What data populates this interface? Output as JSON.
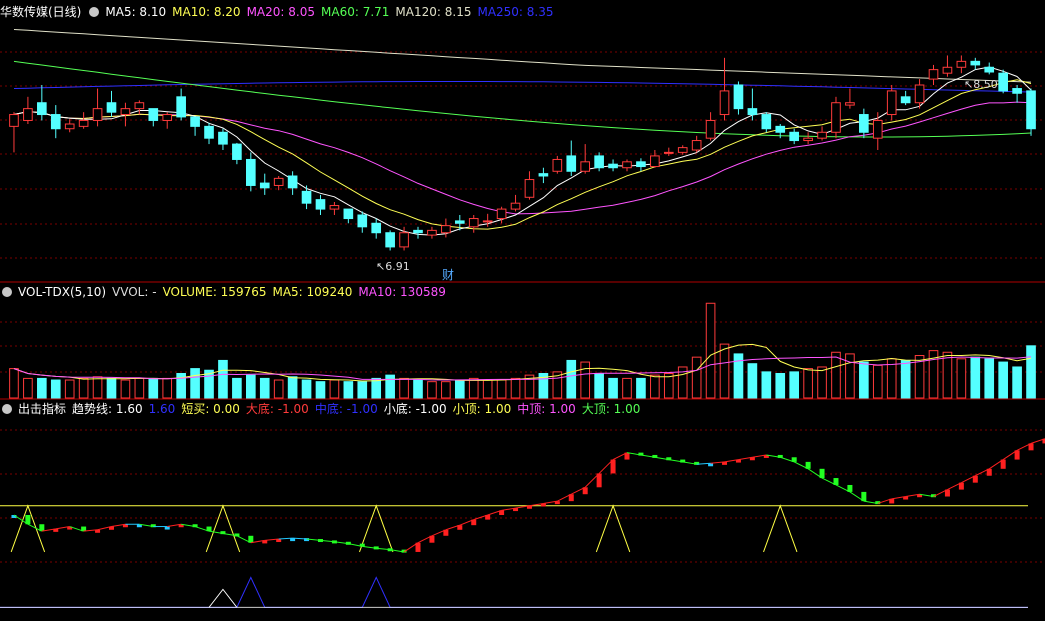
{
  "colors": {
    "up": "#ff3b3b",
    "down": "#54ffff",
    "grid": "#7a0000",
    "ma5": "#ffffff",
    "ma10": "#ffff55",
    "ma20": "#ff55ff",
    "ma60": "#55ff55",
    "ma120": "#e0e0c8",
    "ma250": "#3030ff",
    "trend_up": "#ff2020",
    "trend_down": "#22ff22",
    "trend_flat": "#22c8ff",
    "signal": "#ffff44",
    "signal2": "#3030ff",
    "fin_badge": "#55aaff"
  },
  "price_panel": {
    "title": "华数传媒(日线)",
    "legend": [
      {
        "label": "MA5: 8.10",
        "color": "#ffffff"
      },
      {
        "label": "MA10: 8.20",
        "color": "#ffff55"
      },
      {
        "label": "MA20: 8.05",
        "color": "#ff55ff"
      },
      {
        "label": "MA60: 7.71",
        "color": "#55ff55"
      },
      {
        "label": "MA120: 8.15",
        "color": "#e0e0c8"
      },
      {
        "label": "MA250: 8.35",
        "color": "#3030ff"
      }
    ],
    "high_label": "8.50",
    "low_label": "6.91",
    "fin_badge": "财"
  },
  "volume_panel": {
    "title": "VOL-TDX(5,10)",
    "legend": [
      {
        "label": "VVOL: -",
        "color": "#dddddd"
      },
      {
        "label": "VOLUME: 159765",
        "color": "#ffff55"
      },
      {
        "label": "MA5: 109240",
        "color": "#ffff55"
      },
      {
        "label": "MA10: 130589",
        "color": "#ff55ff"
      }
    ]
  },
  "indicator_panel": {
    "title": "出击指标",
    "legend": [
      {
        "label": "趋势线: 1.60",
        "color": "#ffffff"
      },
      {
        "label": "1.60",
        "color": "#3030ff"
      },
      {
        "label": "短买: 0.00",
        "color": "#ffff55"
      },
      {
        "label": "大底: -1.00",
        "color": "#ff3b3b"
      },
      {
        "label": "中底: -1.00",
        "color": "#3030ff"
      },
      {
        "label": "小底: -1.00",
        "color": "#ffffff"
      },
      {
        "label": "小顶: 1.00",
        "color": "#ffff55"
      },
      {
        "label": "中顶: 1.00",
        "color": "#ff55ff"
      },
      {
        "label": "大顶: 1.00",
        "color": "#55ff55"
      }
    ]
  },
  "chart_data": [
    {
      "type": "candlestick",
      "ylim": [
        6.7,
        8.9
      ],
      "candles": [
        [
          8.0,
          8.1,
          7.85,
          7.78,
          8.12
        ],
        [
          8.05,
          8.15,
          8.2,
          8.02,
          8.25
        ],
        [
          8.2,
          8.1,
          8.3,
          8.05,
          8.35
        ],
        [
          8.1,
          7.98,
          8.15,
          7.9,
          8.18
        ],
        [
          7.98,
          8.02,
          8.05,
          7.95,
          8.06
        ],
        [
          8.0,
          8.05,
          8.1,
          7.98,
          8.12
        ],
        [
          8.05,
          8.15,
          8.3,
          8.0,
          8.32
        ],
        [
          8.2,
          8.12,
          8.28,
          8.08,
          8.3
        ],
        [
          8.1,
          8.15,
          8.1,
          8.0,
          8.2
        ],
        [
          8.15,
          8.2,
          8.15,
          8.1,
          8.22
        ],
        [
          8.15,
          8.05,
          8.1,
          8.0,
          8.12
        ],
        [
          8.05,
          8.1,
          8.05,
          7.98,
          8.12
        ],
        [
          8.25,
          8.08,
          8.3,
          8.05,
          8.32
        ],
        [
          8.08,
          8.0,
          8.05,
          7.92,
          8.06
        ],
        [
          8.0,
          7.9,
          8.02,
          7.85,
          8.03
        ],
        [
          7.95,
          7.85,
          7.95,
          7.8,
          7.98
        ],
        [
          7.85,
          7.72,
          7.82,
          7.68,
          7.86
        ],
        [
          7.72,
          7.5,
          7.75,
          7.45,
          7.78
        ],
        [
          7.52,
          7.48,
          7.58,
          7.42,
          7.6
        ],
        [
          7.5,
          7.56,
          7.55,
          7.46,
          7.58
        ],
        [
          7.58,
          7.48,
          7.6,
          7.42,
          7.62
        ],
        [
          7.45,
          7.35,
          7.48,
          7.3,
          7.5
        ],
        [
          7.38,
          7.3,
          7.4,
          7.25,
          7.42
        ],
        [
          7.3,
          7.33,
          7.3,
          7.25,
          7.36
        ],
        [
          7.3,
          7.22,
          7.28,
          7.18,
          7.3
        ],
        [
          7.25,
          7.15,
          7.26,
          7.1,
          7.28
        ],
        [
          7.18,
          7.1,
          7.2,
          7.05,
          7.22
        ],
        [
          7.1,
          6.98,
          7.08,
          6.95,
          7.12
        ],
        [
          6.98,
          7.1,
          7.05,
          6.95,
          7.15
        ],
        [
          7.12,
          7.1,
          7.12,
          7.05,
          7.15
        ],
        [
          7.08,
          7.12,
          7.1,
          7.05,
          7.15
        ],
        [
          7.1,
          7.16,
          7.18,
          7.06,
          7.22
        ],
        [
          7.2,
          7.18,
          7.22,
          7.12,
          7.25
        ],
        [
          7.15,
          7.22,
          7.18,
          7.1,
          7.25
        ],
        [
          7.2,
          7.2,
          7.22,
          7.15,
          7.26
        ],
        [
          7.22,
          7.3,
          7.28,
          7.18,
          7.32
        ],
        [
          7.3,
          7.35,
          7.4,
          7.28,
          7.42
        ],
        [
          7.4,
          7.55,
          7.6,
          7.38,
          7.62
        ],
        [
          7.6,
          7.58,
          7.62,
          7.52,
          7.65
        ],
        [
          7.62,
          7.72,
          7.7,
          7.6,
          7.75
        ],
        [
          7.75,
          7.62,
          7.78,
          7.58,
          7.88
        ],
        [
          7.62,
          7.7,
          7.75,
          7.6,
          7.85
        ],
        [
          7.75,
          7.65,
          7.7,
          7.62,
          7.78
        ],
        [
          7.68,
          7.65,
          7.7,
          7.62,
          7.72
        ],
        [
          7.65,
          7.7,
          7.68,
          7.62,
          7.72
        ],
        [
          7.7,
          7.66,
          7.7,
          7.62,
          7.73
        ],
        [
          7.66,
          7.75,
          7.78,
          7.65,
          7.8
        ],
        [
          7.78,
          7.78,
          7.8,
          7.75,
          7.82
        ],
        [
          7.78,
          7.82,
          7.8,
          7.76,
          7.84
        ],
        [
          7.8,
          7.88,
          7.9,
          7.78,
          7.92
        ],
        [
          7.9,
          8.05,
          8.1,
          7.88,
          8.12
        ],
        [
          8.1,
          8.3,
          8.35,
          8.05,
          8.58
        ],
        [
          8.35,
          8.15,
          8.2,
          8.1,
          8.38
        ],
        [
          8.15,
          8.1,
          8.15,
          8.05,
          8.32
        ],
        [
          8.1,
          7.98,
          8.05,
          7.95,
          8.12
        ],
        [
          8.0,
          7.95,
          7.98,
          7.9,
          8.02
        ],
        [
          7.95,
          7.88,
          7.95,
          7.85,
          7.98
        ],
        [
          7.88,
          7.9,
          7.92,
          7.85,
          7.95
        ],
        [
          7.9,
          7.95,
          7.95,
          7.88,
          8.0
        ],
        [
          7.95,
          8.2,
          8.22,
          7.9,
          8.25
        ],
        [
          8.18,
          8.2,
          8.25,
          8.15,
          8.32
        ],
        [
          8.1,
          7.95,
          8.1,
          7.9,
          8.15
        ],
        [
          7.9,
          8.05,
          8.1,
          7.8,
          8.12
        ],
        [
          8.1,
          8.3,
          8.32,
          8.05,
          8.35
        ],
        [
          8.25,
          8.2,
          8.25,
          8.18,
          8.3
        ],
        [
          8.2,
          8.35,
          8.38,
          8.15,
          8.4
        ],
        [
          8.4,
          8.48,
          8.45,
          8.35,
          8.52
        ],
        [
          8.45,
          8.5,
          8.48,
          8.42,
          8.6
        ],
        [
          8.5,
          8.55,
          8.52,
          8.45,
          8.6
        ],
        [
          8.55,
          8.52,
          8.52,
          8.48,
          8.58
        ],
        [
          8.5,
          8.46,
          8.5,
          8.44,
          8.54
        ],
        [
          8.45,
          8.3,
          8.4,
          8.28,
          8.48
        ],
        [
          8.32,
          8.28,
          8.32,
          8.2,
          8.35
        ],
        [
          8.3,
          7.98,
          8.28,
          7.92,
          8.32
        ]
      ]
    },
    {
      "type": "bar",
      "ylim": [
        0,
        300000
      ],
      "values": [
        90000,
        60000,
        60000,
        55000,
        55000,
        60000,
        65000,
        60000,
        55000,
        60000,
        60000,
        60000,
        75000,
        90000,
        85000,
        115000,
        60000,
        70000,
        60000,
        55000,
        65000,
        55000,
        50000,
        55000,
        50000,
        50000,
        60000,
        70000,
        60000,
        55000,
        50000,
        50000,
        55000,
        60000,
        55000,
        55000,
        60000,
        70000,
        75000,
        80000,
        115000,
        110000,
        75000,
        60000,
        60000,
        60000,
        70000,
        75000,
        95000,
        125000,
        290000,
        165000,
        135000,
        105000,
        80000,
        75000,
        80000,
        90000,
        95000,
        140000,
        135000,
        110000,
        100000,
        120000,
        115000,
        130000,
        145000,
        140000,
        120000,
        125000,
        120000,
        110000,
        95000,
        159765
      ],
      "series_ma": [
        "ma5",
        "ma10"
      ]
    },
    {
      "type": "line",
      "ylim": [
        -1.3,
        2.9
      ],
      "trend": [
        0.8,
        0.6,
        0.45,
        0.5,
        0.55,
        0.45,
        0.48,
        0.55,
        0.6,
        0.6,
        0.55,
        0.55,
        0.6,
        0.55,
        0.45,
        0.4,
        0.35,
        0.2,
        0.25,
        0.28,
        0.3,
        0.28,
        0.25,
        0.22,
        0.18,
        0.12,
        0.08,
        0.05,
        0.0,
        0.2,
        0.35,
        0.48,
        0.58,
        0.7,
        0.8,
        0.9,
        0.95,
        1.0,
        1.05,
        1.1,
        1.25,
        1.4,
        1.7,
        2.0,
        2.15,
        2.1,
        2.05,
        2.0,
        1.95,
        1.9,
        1.92,
        1.95,
        2.0,
        2.05,
        2.1,
        2.05,
        1.95,
        1.8,
        1.6,
        1.45,
        1.3,
        1.1,
        1.05,
        1.15,
        1.2,
        1.25,
        1.2,
        1.35,
        1.5,
        1.65,
        1.8,
        2.0,
        2.2,
        2.35,
        2.45,
        2.52,
        2.55,
        2.45,
        1.6
      ],
      "signal_peaks": [
        1,
        15,
        26,
        43,
        55
      ],
      "blue_peaks": [
        17,
        26
      ]
    }
  ]
}
